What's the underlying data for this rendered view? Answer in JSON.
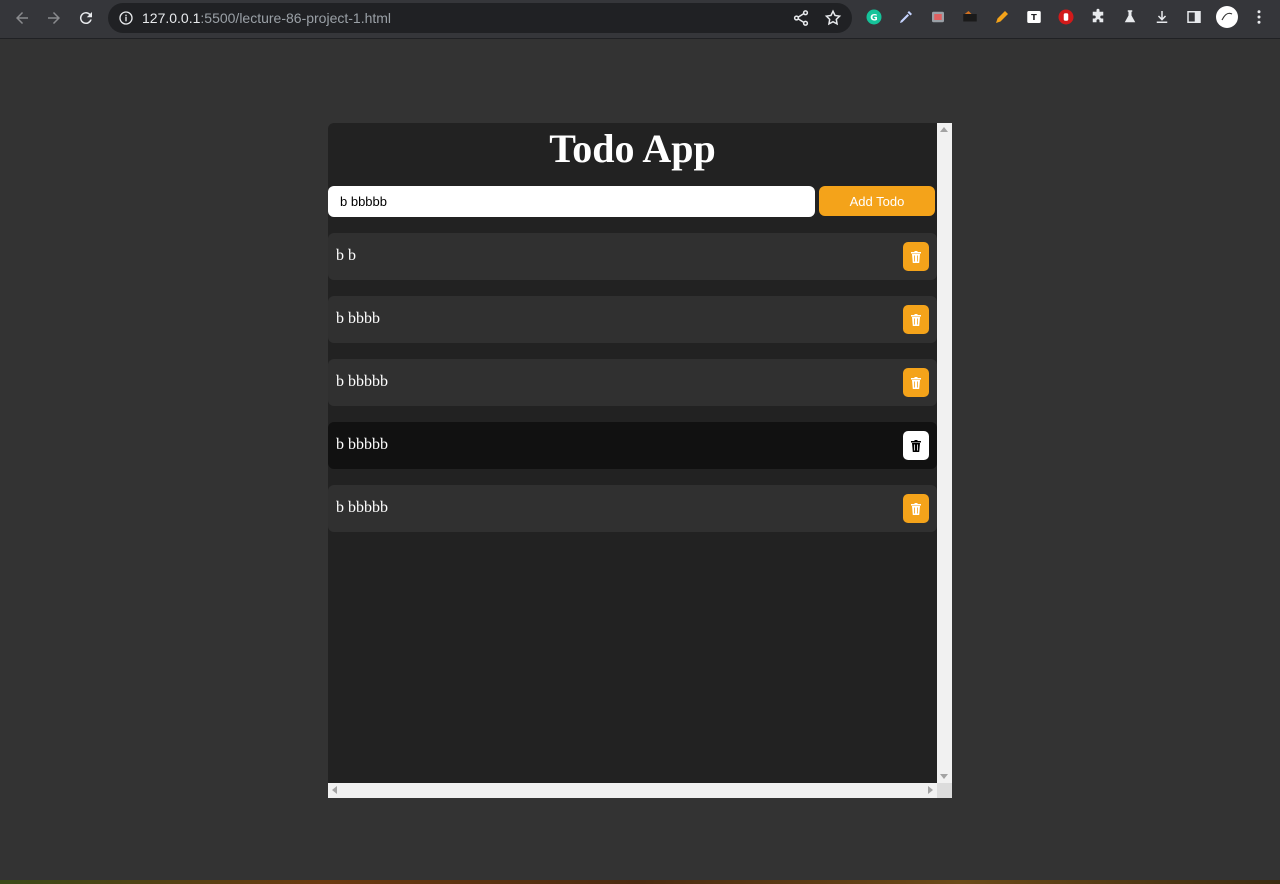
{
  "browser": {
    "url_host": "127.0.0.1",
    "url_path": ":5500/lecture-86-project-1.html",
    "icons": [
      "back-icon",
      "forward-icon",
      "reload-icon",
      "info-icon",
      "share-icon",
      "star-icon",
      "grammarly-icon",
      "eyedropper-icon",
      "extension-icon",
      "extension-icon",
      "pencil-icon",
      "extension-icon",
      "extension-icon",
      "puzzle-icon",
      "flask-icon",
      "download-icon",
      "sidebar-icon",
      "avatar",
      "more-icon"
    ]
  },
  "app": {
    "title": "Todo App",
    "input_value": "b bbbbb",
    "add_label": "Add Todo",
    "accent": "#f4a31a"
  },
  "todos": [
    {
      "text": "b b"
    },
    {
      "text": "b bbbb"
    },
    {
      "text": "b bbbbb"
    },
    {
      "text": "b bbbbb",
      "hovered": true
    },
    {
      "text": "b bbbbb"
    }
  ]
}
